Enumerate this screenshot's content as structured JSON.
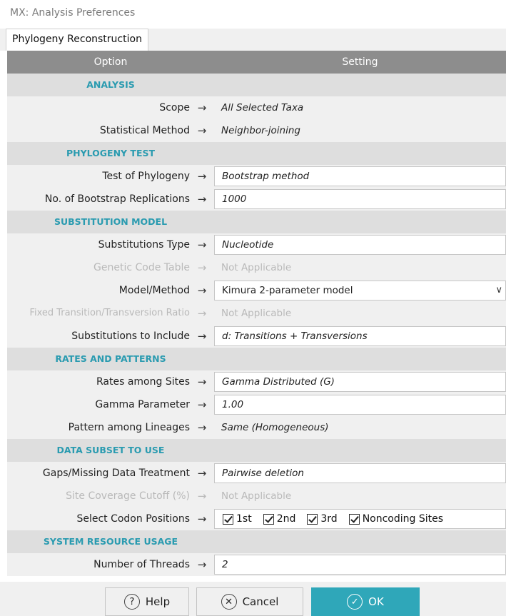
{
  "window": {
    "title": "MX: Analysis Preferences"
  },
  "tabs": [
    {
      "label": "Phylogeny Reconstruction"
    }
  ],
  "grid": {
    "option_header": "Option",
    "setting_header": "Setting"
  },
  "arrow": "→",
  "sections": {
    "analysis": "ANALYSIS",
    "phylogeny_test": "PHYLOGENY TEST",
    "substitution_model": "SUBSTITUTION MODEL",
    "rates_patterns": "RATES AND PATTERNS",
    "data_subset": "DATA SUBSET TO USE",
    "system_resource": "SYSTEM RESOURCE USAGE"
  },
  "rows": {
    "scope": {
      "label": "Scope",
      "value": "All Selected Taxa"
    },
    "statistical_method": {
      "label": "Statistical Method",
      "value": "Neighbor-joining"
    },
    "test_of_phylogeny": {
      "label": "Test of Phylogeny",
      "value": "Bootstrap method"
    },
    "bootstrap_replications": {
      "label": "No. of Bootstrap Replications",
      "value": "1000"
    },
    "substitutions_type": {
      "label": "Substitutions Type",
      "value": "Nucleotide"
    },
    "genetic_code_table": {
      "label": "Genetic Code Table",
      "value": "Not Applicable"
    },
    "model_method": {
      "label": "Model/Method",
      "value": "Kimura 2-parameter model"
    },
    "fixed_ratio": {
      "label": "Fixed Transition/Transversion Ratio",
      "value": "Not Applicable"
    },
    "substitutions_include": {
      "label": "Substitutions to Include",
      "value": "d: Transitions + Transversions"
    },
    "rates_among_sites": {
      "label": "Rates among Sites",
      "value": "Gamma Distributed (G)"
    },
    "gamma_parameter": {
      "label": "Gamma Parameter",
      "value": "1.00"
    },
    "pattern_lineages": {
      "label": "Pattern among Lineages",
      "value": "Same (Homogeneous)"
    },
    "gaps_treatment": {
      "label": "Gaps/Missing Data Treatment",
      "value": "Pairwise deletion"
    },
    "site_coverage": {
      "label": "Site Coverage Cutoff (%)",
      "value": "Not Applicable"
    },
    "codon_positions": {
      "label": "Select Codon Positions",
      "options": [
        "1st",
        "2nd",
        "3rd",
        "Noncoding Sites"
      ]
    },
    "threads": {
      "label": "Number of Threads",
      "value": "2"
    }
  },
  "buttons": {
    "help": "Help",
    "cancel": "Cancel",
    "ok": "OK"
  },
  "icons": {
    "help": "question-circle-icon",
    "cancel": "x-circle-icon",
    "ok": "check-circle-icon",
    "dropdown": "chevron-down-icon"
  },
  "colors": {
    "accent": "#2fa7b9",
    "section_text": "#2a9bb0",
    "header_bg": "#8d8d8d"
  }
}
